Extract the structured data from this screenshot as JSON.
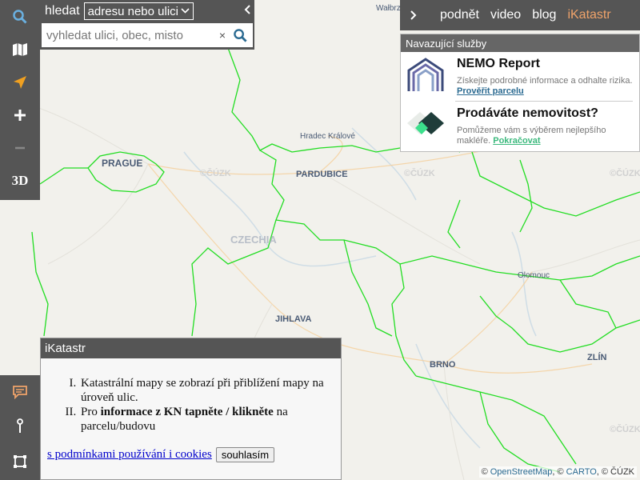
{
  "map": {
    "labels": {
      "prague": "PRAGUE",
      "pardubice": "PARDUBICE",
      "czechia": "CZECHIA",
      "jihlava": "JIHLAVA",
      "brno": "BRNO",
      "zlin": "ZLÍN",
      "hradec": "Hradec Králové",
      "olomouc": "Olomouc",
      "walbrzych": "Wałbrz"
    },
    "watermark": "©ČÚZK"
  },
  "toolbar": {
    "threed_label": "3D"
  },
  "search": {
    "label": "hledat",
    "mode": "adresu nebo ulici",
    "placeholder": "vyhledat ulici, obec, misto",
    "clear": "×"
  },
  "nav": {
    "items": [
      "podnět",
      "video",
      "blog"
    ],
    "brand": "iKatastr"
  },
  "services": {
    "header": "Navazující služby",
    "items": [
      {
        "title": "NEMO Report",
        "desc": "Získejte podrobné informace a odhalte rizika.",
        "link": "Prověřit parcelu"
      },
      {
        "title": "Prodáváte nemovitost?",
        "desc": "Pomůžeme vám s výběrem nejlepšího makléře.",
        "link": "Pokračovat"
      }
    ]
  },
  "info": {
    "title": "iKatastr",
    "item1": "Katastrální mapy se zobrazí při přiblížení mapy na úroveň ulic.",
    "item2_pre": "Pro ",
    "item2_bold": "informace z KN tapněte / klikněte",
    "item2_post": " na parcelu/budovu",
    "terms": "s podmínkami používání i cookies",
    "agree": "souhlasím"
  },
  "attribution": {
    "c1": "©",
    "osm": "OpenStreetMap",
    "sep1": ", ©",
    "carto": "CARTO",
    "sep2": ", © ČÚZK"
  },
  "colors": {
    "boundary": "#22dd22",
    "toolbar": "#555555",
    "accent": "#f0a36a",
    "locate": "#f0a020"
  }
}
